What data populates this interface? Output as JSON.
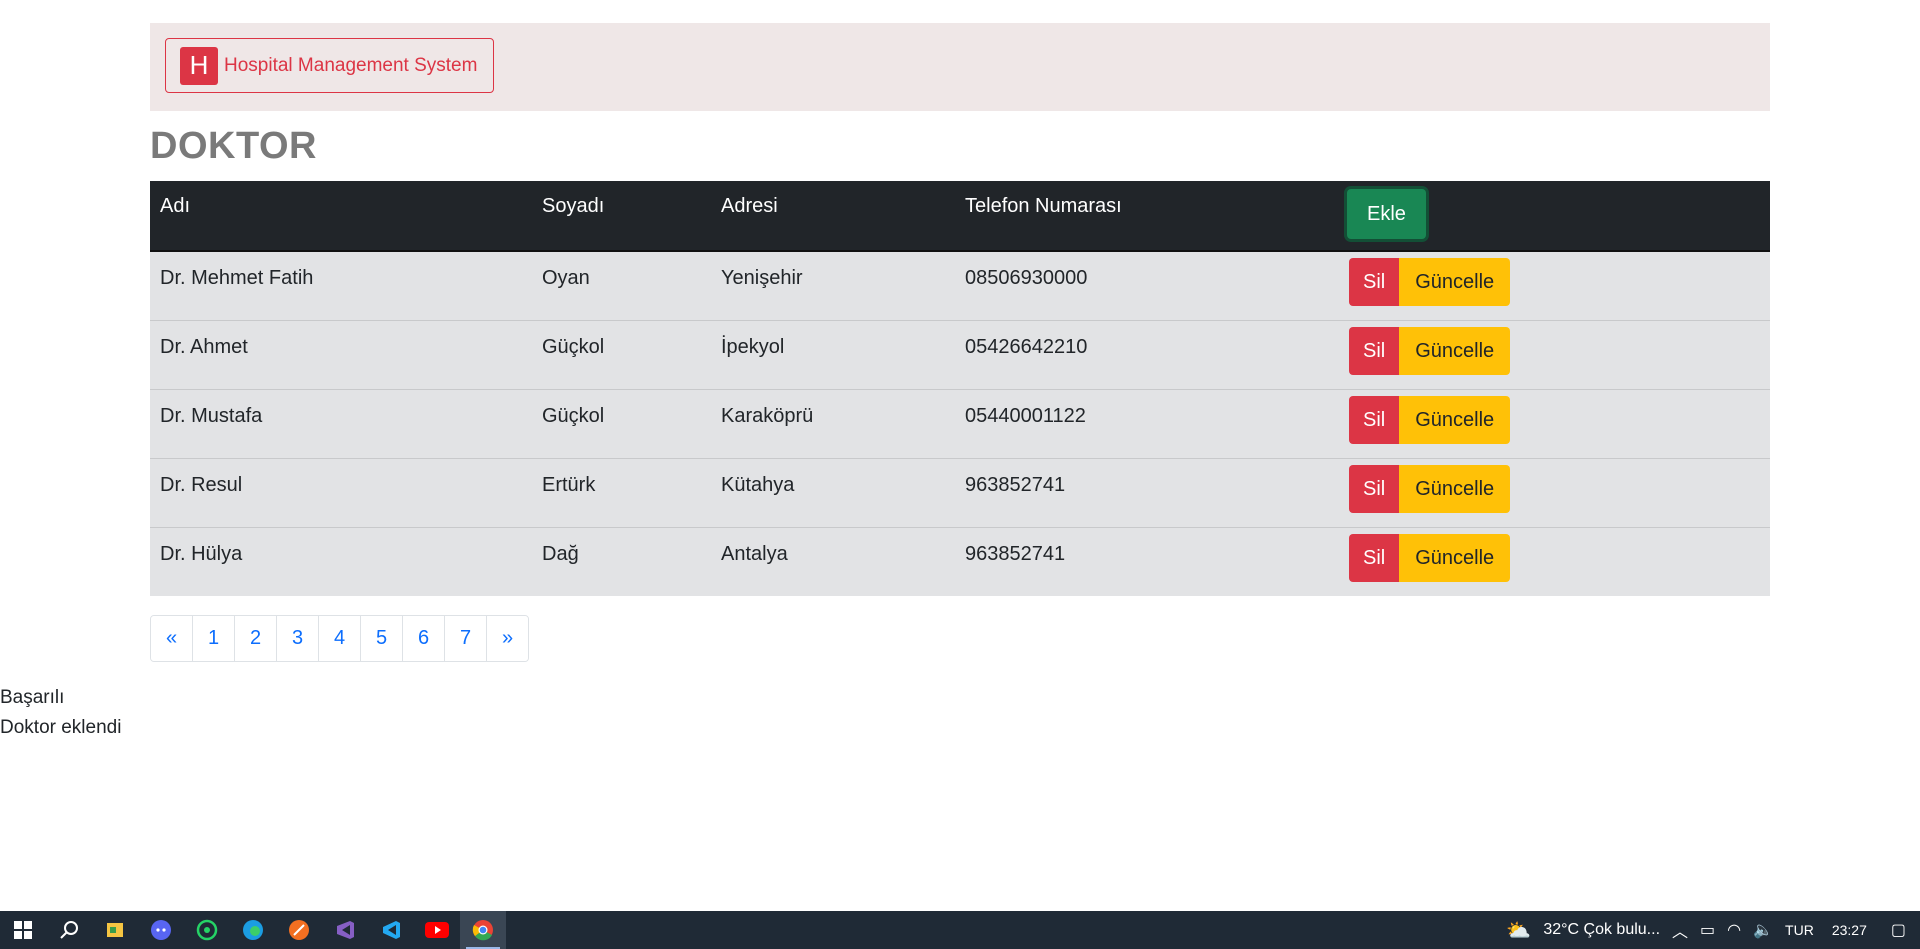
{
  "navbar": {
    "brand_letter": "H",
    "brand_text": "Hospital Management System"
  },
  "page_title": "DOKTOR",
  "table": {
    "headers": [
      "Adı",
      "Soyadı",
      "Adresi",
      "Telefon Numarası"
    ],
    "add_label": "Ekle",
    "delete_label": "Sil",
    "update_label": "Güncelle",
    "rows": [
      [
        "Dr. Mehmet Fatih",
        "Oyan",
        "Yenişehir",
        "08506930000"
      ],
      [
        "Dr. Ahmet",
        "Güçkol",
        "İpekyol",
        "05426642210"
      ],
      [
        "Dr. Mustafa",
        "Güçkol",
        "Karaköprü",
        "05440001122"
      ],
      [
        "Dr. Resul",
        "Ertürk",
        "Kütahya",
        "963852741"
      ],
      [
        "Dr. Hülya",
        "Dağ",
        "Antalya",
        "963852741"
      ]
    ]
  },
  "pagination": [
    "«",
    "1",
    "2",
    "3",
    "4",
    "5",
    "6",
    "7",
    "»"
  ],
  "messages": [
    "Başarılı",
    "Doktor eklendi"
  ],
  "taskbar": {
    "apps": [
      "windows-start-icon",
      "search-icon",
      "file-manager-icon",
      "discord-icon",
      "whatsapp-icon",
      "edge-icon",
      "app-icon",
      "visual-studio-icon",
      "vscode-icon",
      "youtube-icon",
      "chrome-icon"
    ],
    "weather": "32°C  Çok bulu...",
    "language": "TUR",
    "time": "23:27"
  }
}
